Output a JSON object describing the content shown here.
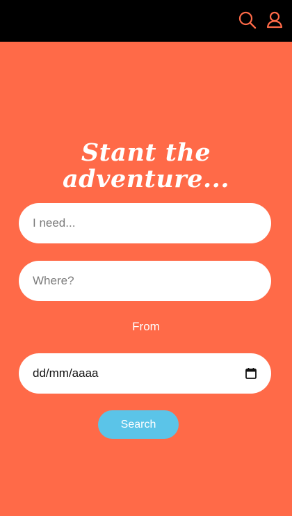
{
  "header": {
    "icons": [
      "search-icon",
      "user-icon"
    ],
    "background_color": "#000000",
    "icon_color": "#ff6a48"
  },
  "hero": {
    "title_line1": "Stant the",
    "title_line2": "adventure..."
  },
  "form": {
    "need_placeholder": "I need...",
    "where_placeholder": "Where?",
    "from_label": "From",
    "date_value": "dd/mm/aaaa",
    "search_label": "Search"
  },
  "colors": {
    "background": "#ff6a48",
    "button": "#5bc4e8",
    "text": "#ffffff"
  }
}
